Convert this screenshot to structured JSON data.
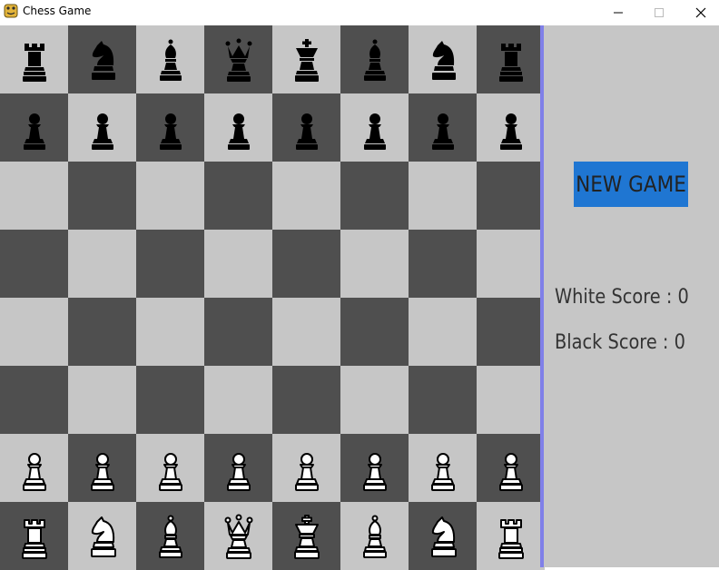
{
  "window": {
    "title": "Chess Game",
    "controls": [
      "minimize",
      "maximize",
      "close"
    ]
  },
  "board": {
    "light_color": "#c6c6c6",
    "dark_color": "#4f4f4f",
    "ranks": [
      [
        {
          "piece": "rook",
          "color": "black"
        },
        {
          "piece": "knight",
          "color": "black"
        },
        {
          "piece": "bishop",
          "color": "black"
        },
        {
          "piece": "queen",
          "color": "black"
        },
        {
          "piece": "king",
          "color": "black"
        },
        {
          "piece": "bishop",
          "color": "black"
        },
        {
          "piece": "knight",
          "color": "black"
        },
        {
          "piece": "rook",
          "color": "black"
        }
      ],
      [
        {
          "piece": "pawn",
          "color": "black"
        },
        {
          "piece": "pawn",
          "color": "black"
        },
        {
          "piece": "pawn",
          "color": "black"
        },
        {
          "piece": "pawn",
          "color": "black"
        },
        {
          "piece": "pawn",
          "color": "black"
        },
        {
          "piece": "pawn",
          "color": "black"
        },
        {
          "piece": "pawn",
          "color": "black"
        },
        {
          "piece": "pawn",
          "color": "black"
        }
      ],
      [
        null,
        null,
        null,
        null,
        null,
        null,
        null,
        null
      ],
      [
        null,
        null,
        null,
        null,
        null,
        null,
        null,
        null
      ],
      [
        null,
        null,
        null,
        null,
        null,
        null,
        null,
        null
      ],
      [
        null,
        null,
        null,
        null,
        null,
        null,
        null,
        null
      ],
      [
        {
          "piece": "pawn",
          "color": "white"
        },
        {
          "piece": "pawn",
          "color": "white"
        },
        {
          "piece": "pawn",
          "color": "white"
        },
        {
          "piece": "pawn",
          "color": "white"
        },
        {
          "piece": "pawn",
          "color": "white"
        },
        {
          "piece": "pawn",
          "color": "white"
        },
        {
          "piece": "pawn",
          "color": "white"
        },
        {
          "piece": "pawn",
          "color": "white"
        }
      ],
      [
        {
          "piece": "rook",
          "color": "white"
        },
        {
          "piece": "knight",
          "color": "white"
        },
        {
          "piece": "bishop",
          "color": "white"
        },
        {
          "piece": "queen",
          "color": "white"
        },
        {
          "piece": "king",
          "color": "white"
        },
        {
          "piece": "bishop",
          "color": "white"
        },
        {
          "piece": "knight",
          "color": "white"
        },
        {
          "piece": "rook",
          "color": "white"
        }
      ]
    ]
  },
  "panel": {
    "new_game_label": "NEW GAME",
    "button_color": "#1f76d2",
    "white_score_text": "White Score : 0",
    "black_score_text": "Black Score : 0"
  }
}
